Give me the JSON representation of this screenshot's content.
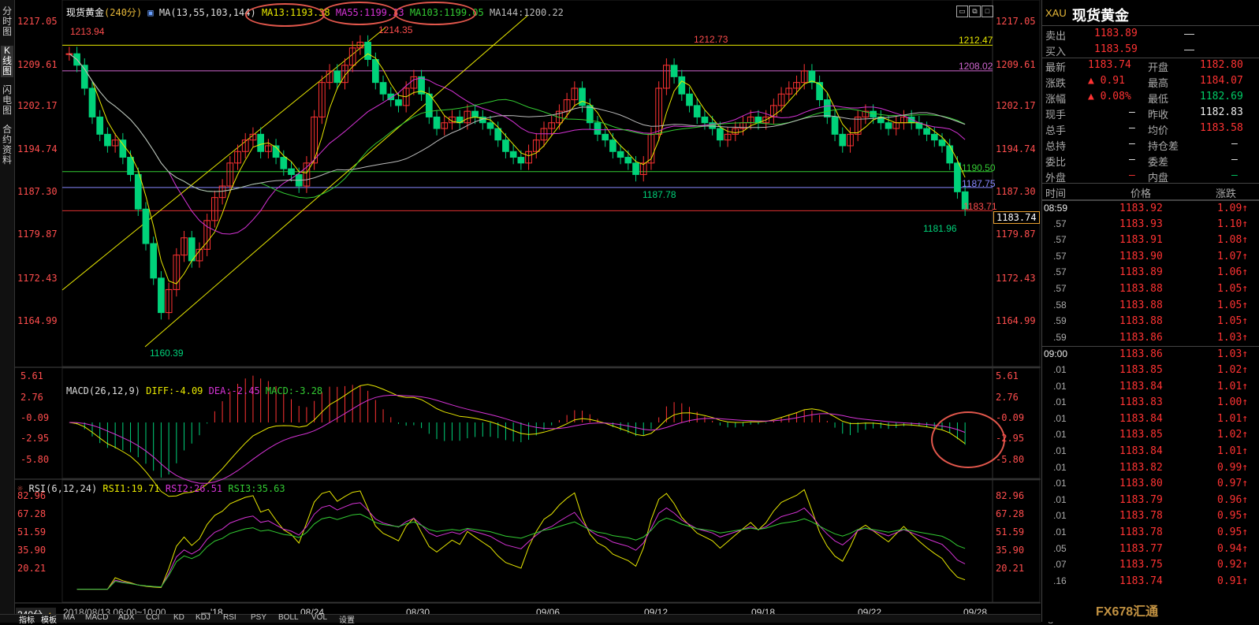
{
  "left_tabs": [
    "分时图",
    "K线图",
    "闪电图",
    "合约资料"
  ],
  "header": {
    "symbol": "现货黄金",
    "period": "240分",
    "ma_params": "MA(13,55,103,144)",
    "ma13": "MA13:1193.38",
    "ma55": "MA55:1199.33",
    "ma103": "MA103:1199.05",
    "ma144": "MA144:1200.22"
  },
  "price_axis": [
    "1217.05",
    "1209.61",
    "1202.17",
    "1194.74",
    "1187.30",
    "1179.87",
    "1172.43",
    "1164.99"
  ],
  "current_price_box": "1183.74",
  "annotations": {
    "high1": "1213.94",
    "high2": "1214.35",
    "high3": "1212.73",
    "low1": "1160.39",
    "low2": "1187.78",
    "low3": "1181.96",
    "last_red": "1183.71",
    "line_yellow": "1212.47",
    "line_magenta": "1208.02",
    "line_green": "1190.50",
    "line_blue": "1187.75"
  },
  "macd": {
    "params": "MACD(26,12,9)",
    "diff": "DIFF:-4.09",
    "dea": "DEA:-2.45",
    "macd": "MACD:-3.28",
    "axis": [
      "5.61",
      "2.76",
      "-0.09",
      "-2.95",
      "-5.80"
    ]
  },
  "rsi": {
    "params": "RSI(6,12,24)",
    "rsi1": "RSI1:19.71",
    "rsi2": "RSI2:26.51",
    "rsi3": "RSI3:35.63",
    "axis": [
      "82.96",
      "67.28",
      "51.59",
      "35.90",
      "20.21"
    ]
  },
  "x_axis": {
    "period_btn": "240分",
    "cursor_time": "2018/08/13 06:00~10:00",
    "first": "—'18",
    "ticks": [
      "08/24",
      "08/30",
      "09/06",
      "09/12",
      "09/18",
      "09/22",
      "09/28"
    ]
  },
  "bottom_tabs": [
    "指标",
    "模板",
    "MA",
    "MACD",
    "ADX",
    "CCI",
    "KD",
    "KDJ",
    "RSI",
    "PSY",
    "BOLL",
    "VOL",
    "设置"
  ],
  "quote": {
    "code": "XAU",
    "name": "现货黄金",
    "sell_label": "卖出",
    "sell": "1183.89",
    "sell_vol": "—",
    "buy_label": "买入",
    "buy": "1183.59",
    "buy_vol": "—",
    "latest_label": "最新",
    "latest": "1183.74",
    "open_label": "开盘",
    "open": "1182.80",
    "change_label": "涨跌",
    "change": "0.91",
    "high_label": "最高",
    "high": "1184.07",
    "pct_label": "涨幅",
    "pct": "0.08%",
    "low_label": "最低",
    "low": "1182.69",
    "hand_label": "现手",
    "hand": "—",
    "prev_label": "昨收",
    "prev": "1182.83",
    "total_label": "总手",
    "total": "—",
    "avg_label": "均价",
    "avg": "1183.58",
    "hold_label": "总持",
    "hold": "—",
    "holdchg_label": "持仓差",
    "holdchg": "—",
    "ratio_label": "委比",
    "ratio": "—",
    "diff_label": "委差",
    "diff": "—",
    "outer_label": "外盘",
    "outer": "—",
    "inner_label": "内盘",
    "inner": "—"
  },
  "ticks_header": {
    "time": "时间",
    "price": "价格",
    "change": "涨跌"
  },
  "ticks": [
    {
      "t": "08:59",
      "p": "1183.92",
      "c": "1.09"
    },
    {
      "t": ".57",
      "p": "1183.93",
      "c": "1.10"
    },
    {
      "t": ".57",
      "p": "1183.91",
      "c": "1.08"
    },
    {
      "t": ".57",
      "p": "1183.90",
      "c": "1.07"
    },
    {
      "t": ".57",
      "p": "1183.89",
      "c": "1.06"
    },
    {
      "t": ".57",
      "p": "1183.88",
      "c": "1.05"
    },
    {
      "t": ".58",
      "p": "1183.88",
      "c": "1.05"
    },
    {
      "t": ".59",
      "p": "1183.88",
      "c": "1.05"
    },
    {
      "t": ".59",
      "p": "1183.86",
      "c": "1.03"
    },
    {
      "t": "09:00",
      "p": "1183.86",
      "c": "1.03"
    },
    {
      "t": ".01",
      "p": "1183.85",
      "c": "1.02"
    },
    {
      "t": ".01",
      "p": "1183.84",
      "c": "1.01"
    },
    {
      "t": ".01",
      "p": "1183.83",
      "c": "1.00"
    },
    {
      "t": ".01",
      "p": "1183.84",
      "c": "1.01"
    },
    {
      "t": ".01",
      "p": "1183.85",
      "c": "1.02"
    },
    {
      "t": ".01",
      "p": "1183.84",
      "c": "1.01"
    },
    {
      "t": ".01",
      "p": "1183.82",
      "c": "0.99"
    },
    {
      "t": ".01",
      "p": "1183.80",
      "c": "0.97"
    },
    {
      "t": ".01",
      "p": "1183.79",
      "c": "0.96"
    },
    {
      "t": ".01",
      "p": "1183.78",
      "c": "0.95"
    },
    {
      "t": ".01",
      "p": "1183.78",
      "c": "0.95"
    },
    {
      "t": ".05",
      "p": "1183.77",
      "c": "0.94"
    },
    {
      "t": ".07",
      "p": "1183.75",
      "c": "0.92"
    },
    {
      "t": ".16",
      "p": "1183.74",
      "c": "0.91"
    }
  ],
  "watermark": "FX678汇通",
  "colors": {
    "up": "#ff3333",
    "down": "#00d27a",
    "ma13": "#e8e800",
    "ma55": "#d633d6",
    "ma103": "#33cc33",
    "ma144": "#bbbbbb",
    "circle": "#e2574c"
  }
}
